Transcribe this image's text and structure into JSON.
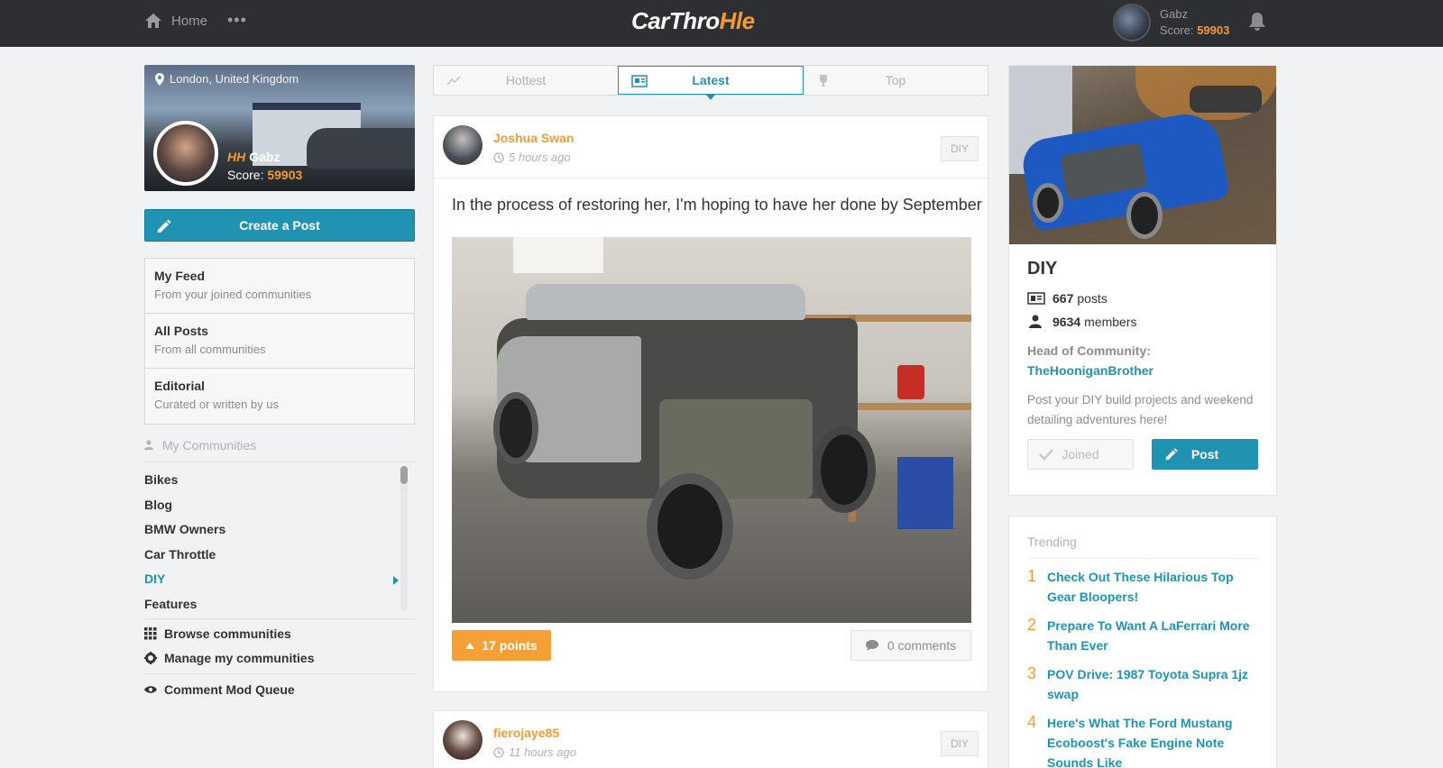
{
  "topbar": {
    "home_label": "Home",
    "more_label": "•••",
    "logo_part1": "CarThro",
    "logo_part2": "Hle",
    "user_name": "Gabz",
    "score_label": "Score:",
    "score_value": "59903"
  },
  "profile": {
    "location": "London, United Kingdom",
    "name": "Gabz",
    "badge": "HH",
    "score_label": "Score:",
    "score_value": "59903"
  },
  "create_post_label": "Create a Post",
  "feeds": [
    {
      "title": "My Feed",
      "subtitle": "From your joined communities"
    },
    {
      "title": "All Posts",
      "subtitle": "From all communities"
    },
    {
      "title": "Editorial",
      "subtitle": "Curated or written by us"
    }
  ],
  "my_communities_label": "My Communities",
  "communities": [
    "Bikes",
    "Blog",
    "BMW Owners",
    "Car Throttle",
    "DIY",
    "Features"
  ],
  "active_community": "DIY",
  "links": {
    "browse": "Browse communities",
    "manage": "Manage my communities",
    "mod_queue": "Comment Mod Queue"
  },
  "tabs": [
    {
      "label": "Hottest",
      "icon": "trending-icon"
    },
    {
      "label": "Latest",
      "icon": "newspaper-icon",
      "active": true
    },
    {
      "label": "Top",
      "icon": "trophy-icon"
    }
  ],
  "post": {
    "author": "Joshua Swan",
    "time": "5 hours ago",
    "tag": "DIY",
    "body": "In the process of restoring her, I'm hoping to have her done by September",
    "points": "17 points",
    "comments": "0 comments"
  },
  "post2": {
    "author": "fierojaye85",
    "time": "11 hours ago",
    "tag": "DIY"
  },
  "community_card": {
    "title": "DIY",
    "posts_count": "667",
    "posts_label": "posts",
    "members_count": "9634",
    "members_label": "members",
    "head_label": "Head of Community:",
    "head_name": "TheHooniganBrother",
    "description": "Post your DIY build projects and weekend detailing adventures here!",
    "joined_label": "Joined",
    "post_label": "Post"
  },
  "trending": {
    "label": "Trending",
    "items": [
      {
        "num": "1",
        "title": "Check Out These Hilarious Top Gear Bloopers!"
      },
      {
        "num": "2",
        "title": "Prepare To Want A LaFerrari More Than Ever"
      },
      {
        "num": "3",
        "title": "POV Drive: 1987 Toyota Supra 1jz swap"
      },
      {
        "num": "4",
        "title": "Here's What The Ford Mustang Ecoboost's Fake Engine Note Sounds Like"
      }
    ]
  },
  "colors": {
    "accent": "#1f93b1",
    "orange": "#f29b2f",
    "topbar": "#2e2f33"
  }
}
